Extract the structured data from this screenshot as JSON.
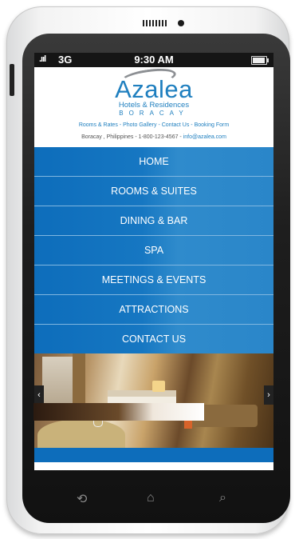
{
  "device": {
    "status_bar": {
      "signal": ".ııl",
      "network": "3G",
      "time": "9:30 AM"
    },
    "nav_buttons": {
      "back": "⟲",
      "home": "⌂",
      "search": "⌕"
    }
  },
  "site": {
    "logo": {
      "name": "Azalea",
      "subtitle": "Hotels & Residences",
      "location": "BORACAY"
    },
    "quick_links": [
      "Rooms & Rates",
      "Photo Gallery",
      "Contact Us",
      "Booking Form"
    ],
    "separator": " - ",
    "contact": {
      "address": "Boracay , Philippines -",
      "phone": "1-800-123-4567 -",
      "email": "info@azalea.com"
    },
    "menu": [
      "HOME",
      "ROOMS & SUITES",
      "DINING & BAR",
      "SPA",
      "MEETINGS & EVENTS",
      "ATTRACTIONS",
      "CONTACT US"
    ],
    "slider": {
      "prev": "‹",
      "next": "›"
    }
  },
  "colors": {
    "brand_blue": "#1f7fbf",
    "nav_blue": "#0d6dbb"
  }
}
